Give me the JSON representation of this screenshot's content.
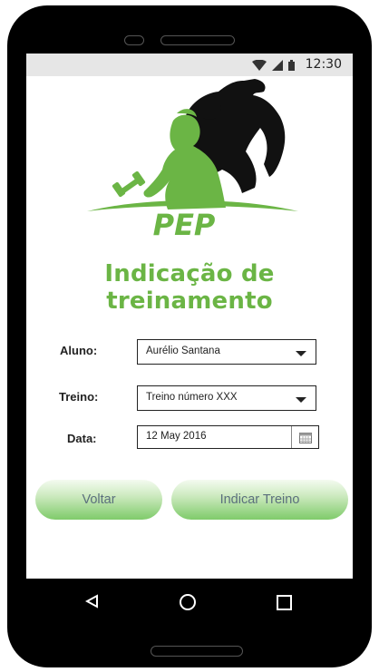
{
  "status_bar": {
    "time": "12:30",
    "icons": [
      "wifi-icon",
      "signal-icon",
      "battery-icon"
    ]
  },
  "logo": {
    "text": "PEP",
    "color": "#6bb545"
  },
  "page": {
    "title": "Indicação de treinamento"
  },
  "form": {
    "student": {
      "label": "Aluno:",
      "value": "Aurélio Santana"
    },
    "workout": {
      "label": "Treino:",
      "value": "Treino número XXX"
    },
    "date": {
      "label": "Data:",
      "value": "12 May 2016"
    }
  },
  "buttons": {
    "back": "Voltar",
    "indicate": "Indicar Treino"
  },
  "navigation": {
    "icons": [
      "back-icon",
      "home-icon",
      "recents-icon"
    ]
  },
  "colors": {
    "accent": "#6bb545",
    "button_text": "#5b6f7d"
  }
}
